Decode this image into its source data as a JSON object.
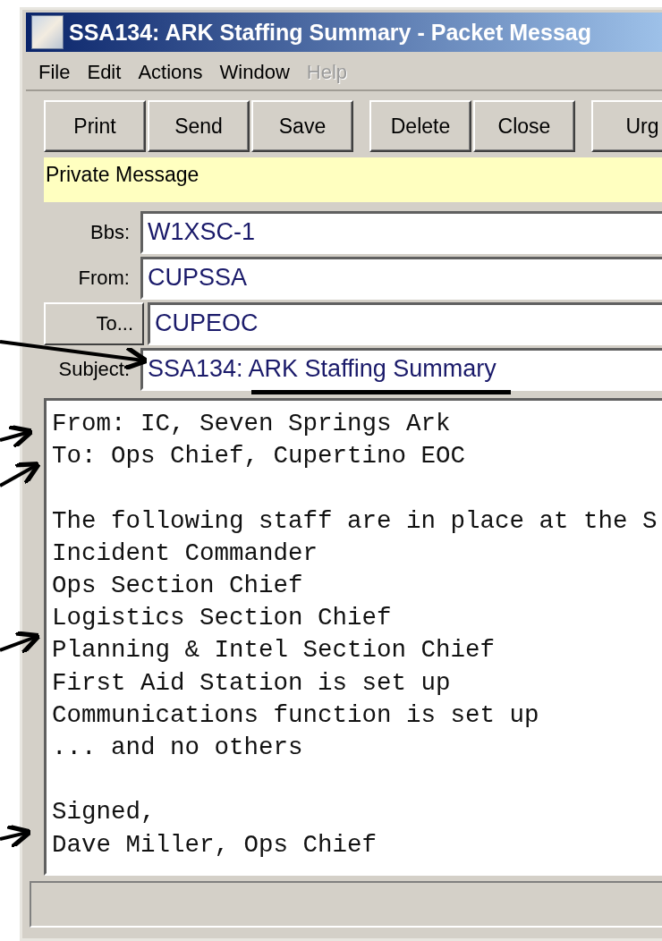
{
  "window": {
    "title": "SSA134: ARK Staffing Summary - Packet Messag"
  },
  "menu": [
    {
      "label": "File",
      "disabled": false
    },
    {
      "label": "Edit",
      "disabled": false
    },
    {
      "label": "Actions",
      "disabled": false
    },
    {
      "label": "Window",
      "disabled": false
    },
    {
      "label": "Help",
      "disabled": true
    }
  ],
  "toolbar": {
    "groups": [
      [
        "Print",
        "Send",
        "Save"
      ],
      [
        "Delete",
        "Close"
      ],
      [
        "Urg"
      ]
    ]
  },
  "banner": "Private Message",
  "fields": [
    {
      "label": "Bbs:",
      "kind": "label",
      "value": "W1XSC-1"
    },
    {
      "label": "From:",
      "kind": "label",
      "value": "CUPSSA"
    },
    {
      "label": "To...",
      "kind": "button",
      "value": "CUPEOC"
    },
    {
      "label": "Subject:",
      "kind": "label",
      "value": "SSA134: ARK Staffing Summary"
    }
  ],
  "body": {
    "paragraphs": [
      [
        "From: IC, Seven Springs Ark",
        "To: Ops Chief, Cupertino EOC"
      ],
      [
        "The following staff are in place at the S",
        "Incident Commander",
        "Ops Section Chief",
        "Logistics Section Chief",
        "Planning & Intel Section Chief",
        "First Aid Station is set up",
        "Communications function is set up",
        "... and no others"
      ],
      [
        "Signed,",
        "Dave Miller, Ops Chief"
      ]
    ]
  }
}
